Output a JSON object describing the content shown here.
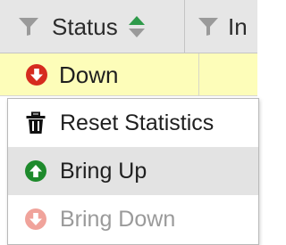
{
  "header": {
    "status_label": "Status",
    "next_column_label": "In",
    "filter_icon": "filter-icon",
    "sort_icon": "sort-icon"
  },
  "row": {
    "status_text": "Down",
    "status_icon": "down-arrow-circle-icon",
    "highlight_color": "#fdfdb9"
  },
  "context_menu": {
    "items": [
      {
        "label": "Reset Statistics",
        "icon": "trash-icon",
        "enabled": true
      },
      {
        "label": "Bring Up",
        "icon": "up-arrow-circle-icon",
        "enabled": true
      },
      {
        "label": "Bring Down",
        "icon": "down-arrow-circle-icon",
        "enabled": false
      }
    ]
  },
  "colors": {
    "header_bg": "#e6e6e6",
    "up_green": "#1e8a2c",
    "down_red": "#d62b1f",
    "disabled_red": "#f0a39b",
    "hover_bg": "#e3e3e3"
  }
}
